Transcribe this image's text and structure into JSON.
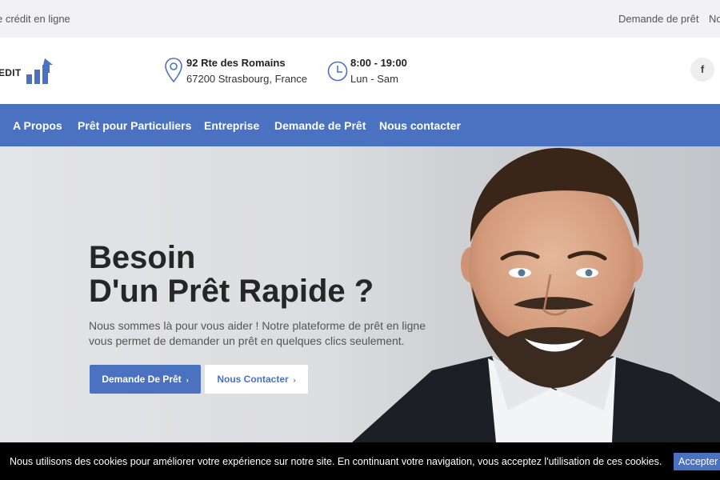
{
  "topbar": {
    "tagline": "e crédit en ligne",
    "links": [
      "Demande de prêt",
      "No"
    ]
  },
  "header": {
    "logo_text": "EDIT",
    "address": {
      "line1": "92 Rte des Romains",
      "line2": "67200 Strasbourg, France",
      "icon": "location-pin-icon"
    },
    "hours": {
      "line1": "8:00 - 19:00",
      "line2": "Lun - Sam",
      "icon": "clock-icon"
    },
    "social": {
      "label": "f",
      "icon": "facebook-icon"
    }
  },
  "nav": {
    "items": [
      "A Propos",
      "Prêt pour Particuliers",
      "Entreprise",
      "Demande de Prêt",
      "Nous contacter"
    ]
  },
  "hero": {
    "title_line1": "Besoin",
    "title_line2": "D'un Prêt Rapide ?",
    "description": "Nous sommes là pour vous aider ! Notre plateforme de prêt en ligne vous permet de demander un prêt en quelques clics seulement.",
    "primary_button": "Demande De Prêt",
    "secondary_button": "Nous Contacter",
    "button_arrow": "›"
  },
  "cookie": {
    "text": "Nous utilisons des cookies pour améliorer votre expérience sur notre site. En continuant votre navigation, vous acceptez l'utilisation de ces cookies.",
    "accept_label": "Accepter"
  },
  "colors": {
    "brand_blue": "#4a72c0",
    "topbar_bg": "#f2f2f4",
    "cookie_bg": "#000000"
  }
}
